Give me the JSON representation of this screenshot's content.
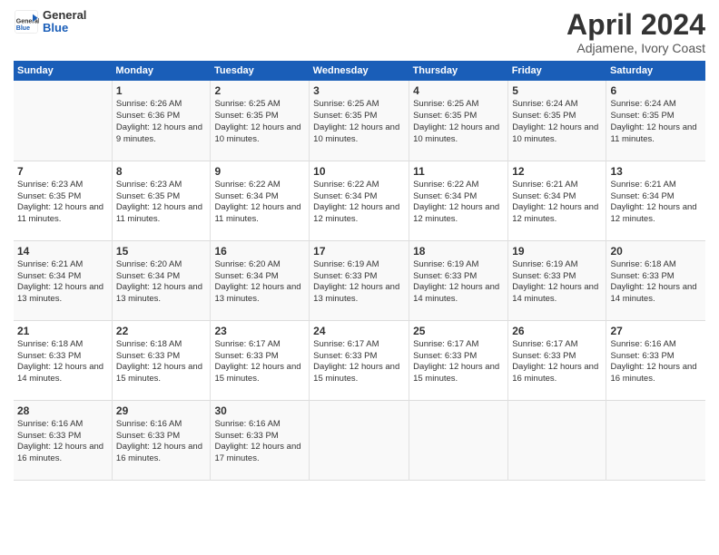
{
  "logo": {
    "text_general": "General",
    "text_blue": "Blue"
  },
  "header": {
    "title": "April 2024",
    "subtitle": "Adjamene, Ivory Coast"
  },
  "days_of_week": [
    "Sunday",
    "Monday",
    "Tuesday",
    "Wednesday",
    "Thursday",
    "Friday",
    "Saturday"
  ],
  "weeks": [
    [
      {
        "num": "",
        "sunrise": "",
        "sunset": "",
        "daylight": ""
      },
      {
        "num": "1",
        "sunrise": "Sunrise: 6:26 AM",
        "sunset": "Sunset: 6:36 PM",
        "daylight": "Daylight: 12 hours and 9 minutes."
      },
      {
        "num": "2",
        "sunrise": "Sunrise: 6:25 AM",
        "sunset": "Sunset: 6:35 PM",
        "daylight": "Daylight: 12 hours and 10 minutes."
      },
      {
        "num": "3",
        "sunrise": "Sunrise: 6:25 AM",
        "sunset": "Sunset: 6:35 PM",
        "daylight": "Daylight: 12 hours and 10 minutes."
      },
      {
        "num": "4",
        "sunrise": "Sunrise: 6:25 AM",
        "sunset": "Sunset: 6:35 PM",
        "daylight": "Daylight: 12 hours and 10 minutes."
      },
      {
        "num": "5",
        "sunrise": "Sunrise: 6:24 AM",
        "sunset": "Sunset: 6:35 PM",
        "daylight": "Daylight: 12 hours and 10 minutes."
      },
      {
        "num": "6",
        "sunrise": "Sunrise: 6:24 AM",
        "sunset": "Sunset: 6:35 PM",
        "daylight": "Daylight: 12 hours and 11 minutes."
      }
    ],
    [
      {
        "num": "7",
        "sunrise": "Sunrise: 6:23 AM",
        "sunset": "Sunset: 6:35 PM",
        "daylight": "Daylight: 12 hours and 11 minutes."
      },
      {
        "num": "8",
        "sunrise": "Sunrise: 6:23 AM",
        "sunset": "Sunset: 6:35 PM",
        "daylight": "Daylight: 12 hours and 11 minutes."
      },
      {
        "num": "9",
        "sunrise": "Sunrise: 6:22 AM",
        "sunset": "Sunset: 6:34 PM",
        "daylight": "Daylight: 12 hours and 11 minutes."
      },
      {
        "num": "10",
        "sunrise": "Sunrise: 6:22 AM",
        "sunset": "Sunset: 6:34 PM",
        "daylight": "Daylight: 12 hours and 12 minutes."
      },
      {
        "num": "11",
        "sunrise": "Sunrise: 6:22 AM",
        "sunset": "Sunset: 6:34 PM",
        "daylight": "Daylight: 12 hours and 12 minutes."
      },
      {
        "num": "12",
        "sunrise": "Sunrise: 6:21 AM",
        "sunset": "Sunset: 6:34 PM",
        "daylight": "Daylight: 12 hours and 12 minutes."
      },
      {
        "num": "13",
        "sunrise": "Sunrise: 6:21 AM",
        "sunset": "Sunset: 6:34 PM",
        "daylight": "Daylight: 12 hours and 12 minutes."
      }
    ],
    [
      {
        "num": "14",
        "sunrise": "Sunrise: 6:21 AM",
        "sunset": "Sunset: 6:34 PM",
        "daylight": "Daylight: 12 hours and 13 minutes."
      },
      {
        "num": "15",
        "sunrise": "Sunrise: 6:20 AM",
        "sunset": "Sunset: 6:34 PM",
        "daylight": "Daylight: 12 hours and 13 minutes."
      },
      {
        "num": "16",
        "sunrise": "Sunrise: 6:20 AM",
        "sunset": "Sunset: 6:34 PM",
        "daylight": "Daylight: 12 hours and 13 minutes."
      },
      {
        "num": "17",
        "sunrise": "Sunrise: 6:19 AM",
        "sunset": "Sunset: 6:33 PM",
        "daylight": "Daylight: 12 hours and 13 minutes."
      },
      {
        "num": "18",
        "sunrise": "Sunrise: 6:19 AM",
        "sunset": "Sunset: 6:33 PM",
        "daylight": "Daylight: 12 hours and 14 minutes."
      },
      {
        "num": "19",
        "sunrise": "Sunrise: 6:19 AM",
        "sunset": "Sunset: 6:33 PM",
        "daylight": "Daylight: 12 hours and 14 minutes."
      },
      {
        "num": "20",
        "sunrise": "Sunrise: 6:18 AM",
        "sunset": "Sunset: 6:33 PM",
        "daylight": "Daylight: 12 hours and 14 minutes."
      }
    ],
    [
      {
        "num": "21",
        "sunrise": "Sunrise: 6:18 AM",
        "sunset": "Sunset: 6:33 PM",
        "daylight": "Daylight: 12 hours and 14 minutes."
      },
      {
        "num": "22",
        "sunrise": "Sunrise: 6:18 AM",
        "sunset": "Sunset: 6:33 PM",
        "daylight": "Daylight: 12 hours and 15 minutes."
      },
      {
        "num": "23",
        "sunrise": "Sunrise: 6:17 AM",
        "sunset": "Sunset: 6:33 PM",
        "daylight": "Daylight: 12 hours and 15 minutes."
      },
      {
        "num": "24",
        "sunrise": "Sunrise: 6:17 AM",
        "sunset": "Sunset: 6:33 PM",
        "daylight": "Daylight: 12 hours and 15 minutes."
      },
      {
        "num": "25",
        "sunrise": "Sunrise: 6:17 AM",
        "sunset": "Sunset: 6:33 PM",
        "daylight": "Daylight: 12 hours and 15 minutes."
      },
      {
        "num": "26",
        "sunrise": "Sunrise: 6:17 AM",
        "sunset": "Sunset: 6:33 PM",
        "daylight": "Daylight: 12 hours and 16 minutes."
      },
      {
        "num": "27",
        "sunrise": "Sunrise: 6:16 AM",
        "sunset": "Sunset: 6:33 PM",
        "daylight": "Daylight: 12 hours and 16 minutes."
      }
    ],
    [
      {
        "num": "28",
        "sunrise": "Sunrise: 6:16 AM",
        "sunset": "Sunset: 6:33 PM",
        "daylight": "Daylight: 12 hours and 16 minutes."
      },
      {
        "num": "29",
        "sunrise": "Sunrise: 6:16 AM",
        "sunset": "Sunset: 6:33 PM",
        "daylight": "Daylight: 12 hours and 16 minutes."
      },
      {
        "num": "30",
        "sunrise": "Sunrise: 6:16 AM",
        "sunset": "Sunset: 6:33 PM",
        "daylight": "Daylight: 12 hours and 17 minutes."
      },
      {
        "num": "",
        "sunrise": "",
        "sunset": "",
        "daylight": ""
      },
      {
        "num": "",
        "sunrise": "",
        "sunset": "",
        "daylight": ""
      },
      {
        "num": "",
        "sunrise": "",
        "sunset": "",
        "daylight": ""
      },
      {
        "num": "",
        "sunrise": "",
        "sunset": "",
        "daylight": ""
      }
    ]
  ]
}
